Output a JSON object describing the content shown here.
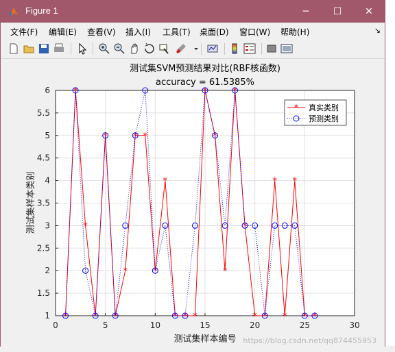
{
  "window": {
    "title": "Figure 1",
    "controls": [
      "─",
      "☐",
      "✕"
    ]
  },
  "menu": {
    "items": [
      "文件(F)",
      "编辑(E)",
      "查看(V)",
      "插入(I)",
      "工具(T)",
      "桌面(D)",
      "窗口(W)",
      "帮助(H)"
    ],
    "overflow": "↘"
  },
  "toolbar": {
    "icons": [
      "new-figure-icon",
      "open-file-icon",
      "save-icon",
      "print-icon",
      "edit-plot-arrow-icon",
      "zoom-in-icon",
      "zoom-out-icon",
      "pan-hand-icon",
      "rotate-3d-icon",
      "data-cursor-icon",
      "brush-icon",
      "link-plot-icon",
      "colorbar-icon",
      "legend-icon",
      "hide-plot-tools-icon",
      "show-plot-tools-icon"
    ]
  },
  "chart_data": {
    "type": "line",
    "title": "测试集SVM预测结果对比(RBF核函数)",
    "subtitle": "accuracy = 61.5385%",
    "xlabel": "测试集样本编号",
    "ylabel": "测试集样本类别",
    "xlim": [
      0,
      30
    ],
    "ylim": [
      1,
      6
    ],
    "xticks": [
      0,
      5,
      10,
      15,
      20,
      25,
      30
    ],
    "yticks": [
      1,
      1.5,
      2,
      2.5,
      3,
      3.5,
      4,
      4.5,
      5,
      5.5,
      6
    ],
    "grid": true,
    "legend_position": "top-right",
    "x": [
      1,
      2,
      3,
      4,
      5,
      6,
      7,
      8,
      9,
      10,
      11,
      12,
      13,
      14,
      15,
      16,
      17,
      18,
      19,
      20,
      21,
      22,
      23,
      24,
      25,
      26
    ],
    "series": [
      {
        "name": "真实类别",
        "color": "#ff0000",
        "line": "solid",
        "marker": "star",
        "values": [
          1,
          6,
          3,
          1,
          5,
          1,
          2,
          5,
          5,
          2,
          4,
          1,
          1,
          1,
          6,
          5,
          2,
          6,
          3,
          1,
          1,
          4,
          1,
          4,
          1,
          1
        ]
      },
      {
        "name": "预测类别",
        "color": "#0000ff",
        "line": "dotted",
        "marker": "circle",
        "values": [
          1,
          6,
          2,
          1,
          5,
          1,
          3,
          5,
          6,
          2,
          3,
          1,
          1,
          3,
          6,
          5,
          3,
          6,
          3,
          3,
          1,
          3,
          3,
          3,
          1,
          1
        ]
      }
    ]
  },
  "watermark": "https://blog.csdn.net/qq874455953"
}
